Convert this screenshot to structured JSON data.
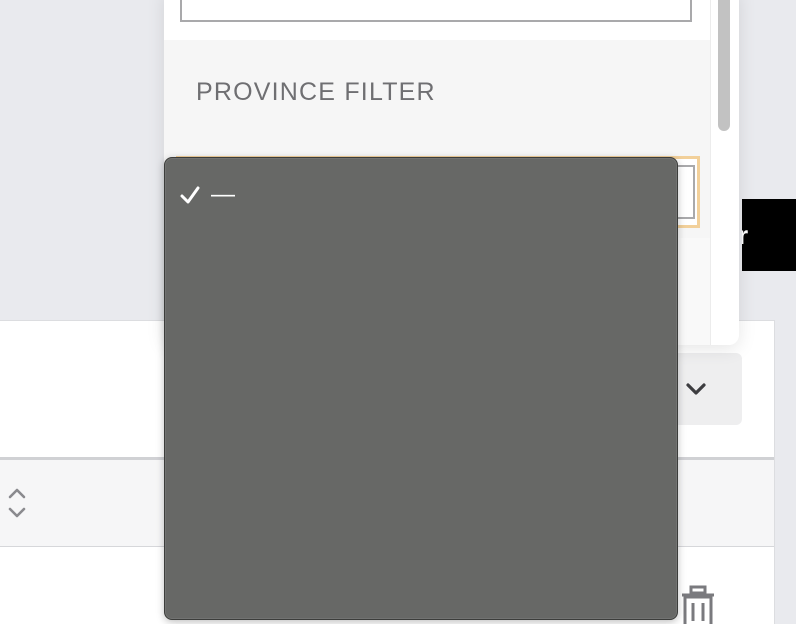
{
  "filter_panel": {
    "section_label": "PROVINCE FILTER",
    "province_select": {
      "value": ""
    }
  },
  "dropdown": {
    "options": [
      {
        "label": "—",
        "selected": true
      }
    ]
  },
  "background": {
    "dark_button_label": "r"
  },
  "colors": {
    "menu_background": "#676866",
    "select_focus_ring": "#f2d09a",
    "dark_button": "#000000",
    "panel_background": "#f6f6f6"
  }
}
